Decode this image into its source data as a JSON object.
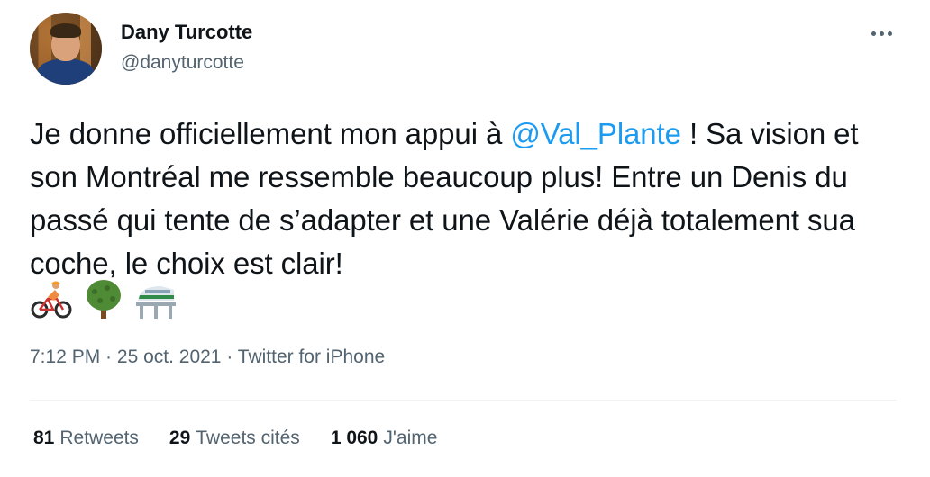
{
  "author": {
    "name": "Dany Turcotte",
    "handle": "@danyturcotte"
  },
  "icons": {
    "more": "more-horizontal-icon",
    "emojis": [
      "cyclist-emoji",
      "deciduous-tree-emoji",
      "light-rail-emoji"
    ]
  },
  "tweet": {
    "text_before": "Je donne officiellement mon appui à ",
    "mention": "@Val_Plante",
    "text_after": " ! Sa vision et son Montréal me ressemble beaucoup plus! Entre un Denis du passé qui tente de s’adapter et une Valérie déjà totalement sua coche, le choix est clair!"
  },
  "meta": {
    "time": "7:12 PM",
    "sep1": " · ",
    "date": "25 oct. 2021",
    "sep2": " · ",
    "source": "Twitter for iPhone"
  },
  "stats": {
    "retweets_count": "81",
    "retweets_label": "Retweets",
    "quotes_count": "29",
    "quotes_label": "Tweets cités",
    "likes_count": "1 060",
    "likes_label": "J'aime"
  },
  "colors": {
    "link": "#1d9bf0",
    "secondary_text": "#536471",
    "primary_text": "#0f1419",
    "divider": "#eff3f4"
  }
}
